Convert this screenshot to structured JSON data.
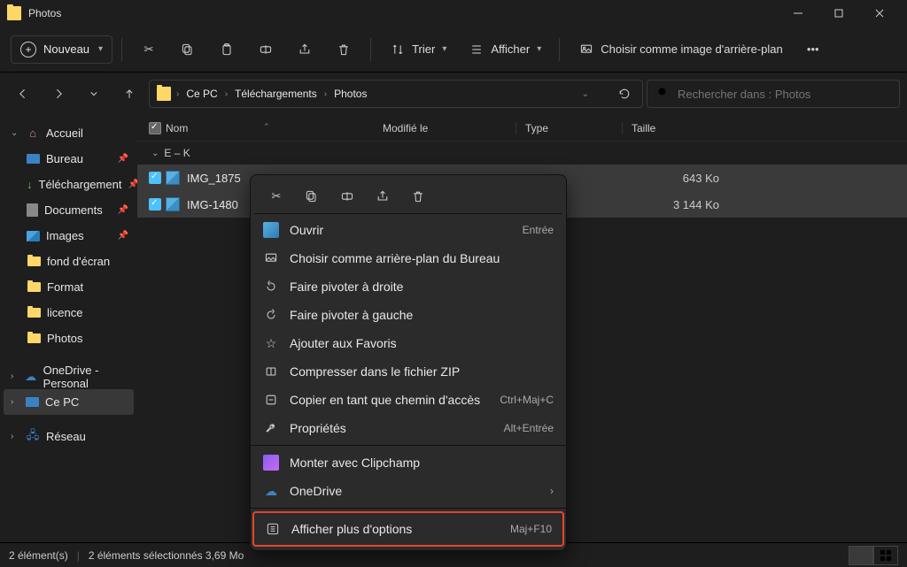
{
  "window": {
    "title": "Photos"
  },
  "toolbar": {
    "new": "Nouveau",
    "sort": "Trier",
    "view": "Afficher",
    "set_bg": "Choisir comme image d'arrière-plan"
  },
  "breadcrumb": {
    "items": [
      "Ce PC",
      "Téléchargements",
      "Photos"
    ]
  },
  "search": {
    "placeholder": "Rechercher dans : Photos"
  },
  "sidebar": {
    "home": "Accueil",
    "desktop": "Bureau",
    "downloads": "Téléchargement",
    "documents": "Documents",
    "images": "Images",
    "wallpaper": "fond d'écran",
    "format": "Format",
    "licence": "licence",
    "photos": "Photos",
    "onedrive": "OneDrive - Personal",
    "thispc": "Ce PC",
    "network": "Réseau"
  },
  "columns": {
    "name": "Nom",
    "modified": "Modifié le",
    "type": "Type",
    "size": "Taille"
  },
  "group": {
    "label": "E – K"
  },
  "files": [
    {
      "name": "IMG_1875",
      "size": "643 Ko"
    },
    {
      "name": "IMG-1480",
      "size": "3 144 Ko"
    }
  ],
  "contextmenu": {
    "open": "Ouvrir",
    "open_sc": "Entrée",
    "set_bg": "Choisir comme arrière-plan du Bureau",
    "rotate_r": "Faire pivoter à droite",
    "rotate_l": "Faire pivoter à gauche",
    "fav": "Ajouter aux Favoris",
    "zip": "Compresser dans le fichier ZIP",
    "copy_path": "Copier en tant que chemin d'accès",
    "copy_path_sc": "Ctrl+Maj+C",
    "props": "Propriétés",
    "props_sc": "Alt+Entrée",
    "clipchamp": "Monter avec Clipchamp",
    "onedrive": "OneDrive",
    "more": "Afficher plus d'options",
    "more_sc": "Maj+F10"
  },
  "status": {
    "count": "2 élément(s)",
    "selected": "2 éléments sélectionnés  3,69 Mo"
  }
}
